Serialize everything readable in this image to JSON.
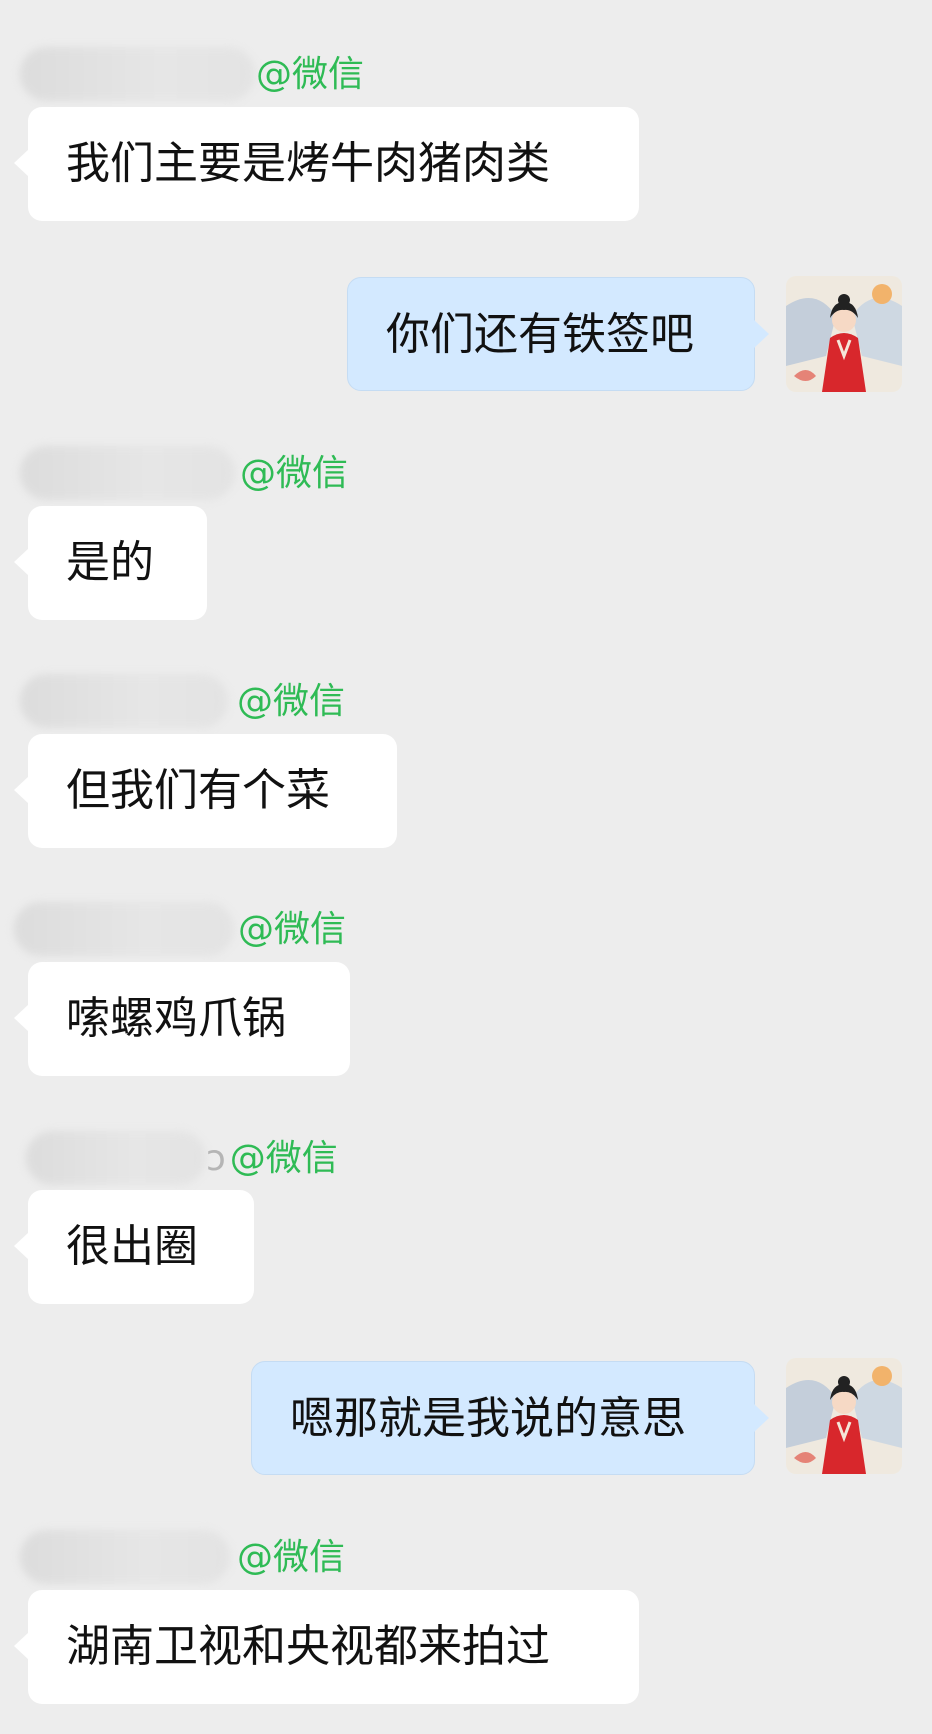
{
  "messages": [
    {
      "side": "in",
      "tag_prefix": "",
      "tag": "@微信",
      "text": "我们主要是烤牛肉猪肉类"
    },
    {
      "side": "out",
      "text": "你们还有铁签吧"
    },
    {
      "side": "in",
      "tag_prefix": "",
      "tag": "@微信",
      "text": "是的"
    },
    {
      "side": "in",
      "tag_prefix": "",
      "tag": "@微信",
      "text": "但我们有个菜"
    },
    {
      "side": "in",
      "tag_prefix": "",
      "tag": "@微信",
      "text": "嗦螺鸡爪锅"
    },
    {
      "side": "in",
      "tag_prefix": "ɔ",
      "tag": "@微信",
      "text": "很出圈"
    },
    {
      "side": "out",
      "text": "嗯那就是我说的意思"
    },
    {
      "side": "in",
      "tag_prefix": "",
      "tag": "@微信",
      "text": "湖南卫视和央视都来拍过"
    }
  ],
  "avatar_icon": "avatar-woman-red-hanfu",
  "colors": {
    "background": "#ededed",
    "incoming_bubble": "#ffffff",
    "outgoing_bubble": "#d3e9ff",
    "tag_green": "#2fbb55"
  }
}
